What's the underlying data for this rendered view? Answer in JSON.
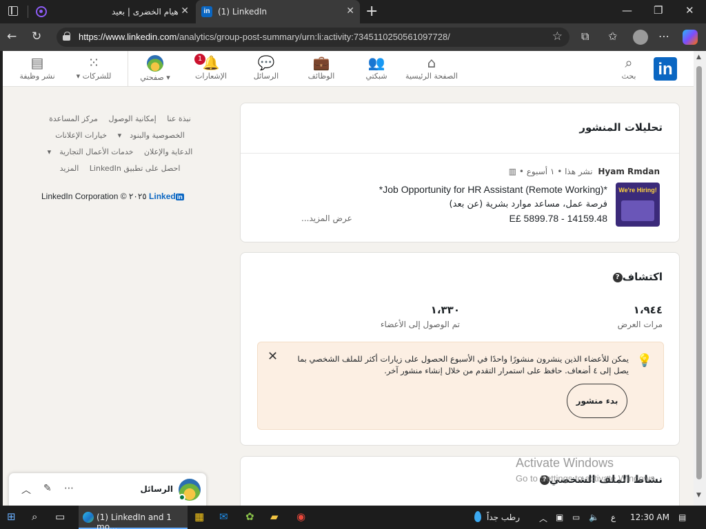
{
  "browser": {
    "tabs": [
      {
        "label": "هيام الخضرى | بعيد",
        "active": false
      },
      {
        "label": "(1) LinkedIn",
        "active": true
      }
    ],
    "url_host": "https://www.linkedin.com",
    "url_path": "/analytics/group-post-summary/urn:li:activity:7345110250561097728/"
  },
  "header": {
    "logo": "in",
    "search": "بحث",
    "nav": [
      {
        "label": "الصفحة الرئيسية",
        "icon": "home-icon"
      },
      {
        "label": "شبكتي",
        "icon": "network-icon"
      },
      {
        "label": "الوظائف",
        "icon": "briefcase-icon"
      },
      {
        "label": "الرسائل",
        "icon": "messaging-icon"
      },
      {
        "label": "الإشعارات",
        "icon": "bell-icon",
        "badge": "1"
      },
      {
        "label": "صفحتي",
        "icon": "me-avatar"
      },
      {
        "label": "للشركات",
        "icon": "grid-icon"
      },
      {
        "label": "نشر وظيفة",
        "icon": "post-job-icon"
      }
    ]
  },
  "footer": {
    "row1": [
      "نبذة عنا",
      "إمكانية الوصول",
      "مركز المساعدة"
    ],
    "row2": [
      "الخصوصية والبنود",
      "خيارات الإعلانات"
    ],
    "row3": [
      "الدعاية والإعلان",
      "خدمات الأعمال التجارية"
    ],
    "row4": [
      "احصل على تطبيق LinkedIn",
      "المزيد"
    ],
    "corp": "LinkedIn Corporation © ٢٠٢٥",
    "corp_logo": "Linked"
  },
  "post_card": {
    "title": "تحليلات المنشور",
    "author": "Hyam Rmdan",
    "meta": "نشر هذا • ١ أسبوع •",
    "thumb_text": "We're Hiring!",
    "line1": "*Job Opportunity for HR Assistant (Remote Working)*",
    "line2": "فرصة عمل، مساعد موارد بشرية (عن بعد)",
    "line3": "E£ 5899.78 - 14159.48",
    "see_more": "عرض المزيد..."
  },
  "discovery": {
    "title": "اكتشاف",
    "impressions_value": "١،٩٤٤",
    "impressions_label": "مرات العرض",
    "reach_value": "١،٣٣٠",
    "reach_label": "تم الوصول إلى الأعضاء",
    "tip_text": "يمكن للأعضاء الذين ينشرون منشورًا واحدًا في الأسبوع الحصول على زيارات أكثر للملف الشخصي بما يصل إلى ٤ أضعاف. حافظ على استمرار التقدم من خلال إنشاء منشور آخر.",
    "start_post": "بدء منشور"
  },
  "profile_activity": {
    "title": "نشاط الملف الشخصي"
  },
  "watermark": {
    "line1": "Activate Windows",
    "line2": "Go to Settings to activate Windows."
  },
  "messaging": {
    "title": "الرسائل"
  },
  "taskbar": {
    "edge_label": "(1) LinkedIn and 1 mo...",
    "weather": "رطب جداً",
    "lang": "ع",
    "time": "12:30 AM"
  },
  "colors": {
    "linkedin_blue": "#0a66c2",
    "badge_red": "#cb112d",
    "tip_bg": "#fcefe3"
  }
}
